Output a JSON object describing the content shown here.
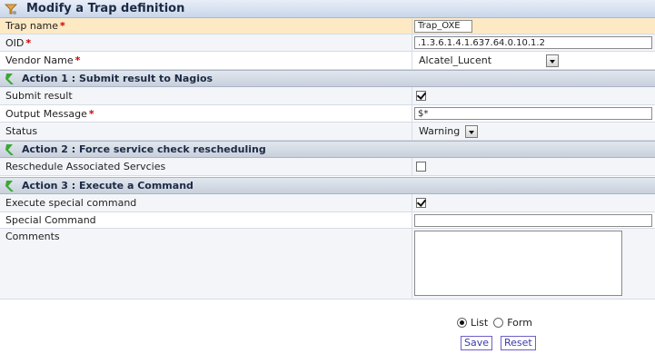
{
  "form": {
    "title": "Modify a Trap definition",
    "rows": {
      "trap_name": {
        "label": "Trap name",
        "required": "*",
        "value": "Trap_OXE"
      },
      "oid": {
        "label": "OID",
        "required": "*",
        "value": ".1.3.6.1.4.1.637.64.0.10.1.2"
      },
      "vendor": {
        "label": "Vendor Name",
        "required": "*",
        "selected": "Alcatel_Lucent"
      }
    }
  },
  "sections": {
    "action1": {
      "title": "Action 1 : Submit result to Nagios",
      "submit_result": {
        "label": "Submit result",
        "checked": true
      },
      "output_message": {
        "label": "Output Message",
        "required": "*",
        "value": "$*"
      },
      "status": {
        "label": "Status",
        "selected": "Warning"
      }
    },
    "action2": {
      "title": "Action 2 : Force service check rescheduling",
      "reschedule": {
        "label": "Reschedule Associated Servcies",
        "checked": false
      }
    },
    "action3": {
      "title": "Action 3 : Execute a Command",
      "execute": {
        "label": "Execute special command",
        "checked": true
      },
      "special_command": {
        "label": "Special Command",
        "value": ""
      },
      "comments": {
        "label": "Comments",
        "value": ""
      }
    }
  },
  "footer": {
    "radio_list": "List",
    "radio_form": "Form",
    "selected_mode": "List",
    "save_label": "Save",
    "reset_label": "Reset"
  },
  "icons": {
    "title_icon": "funnel-wrench-icon",
    "section_icon": "green-arrow-icon"
  },
  "colors": {
    "header_row": "#fde9c4",
    "section_bar": "#c8d0dc",
    "required": "#cc0000",
    "button_border": "#6d5fc7"
  }
}
